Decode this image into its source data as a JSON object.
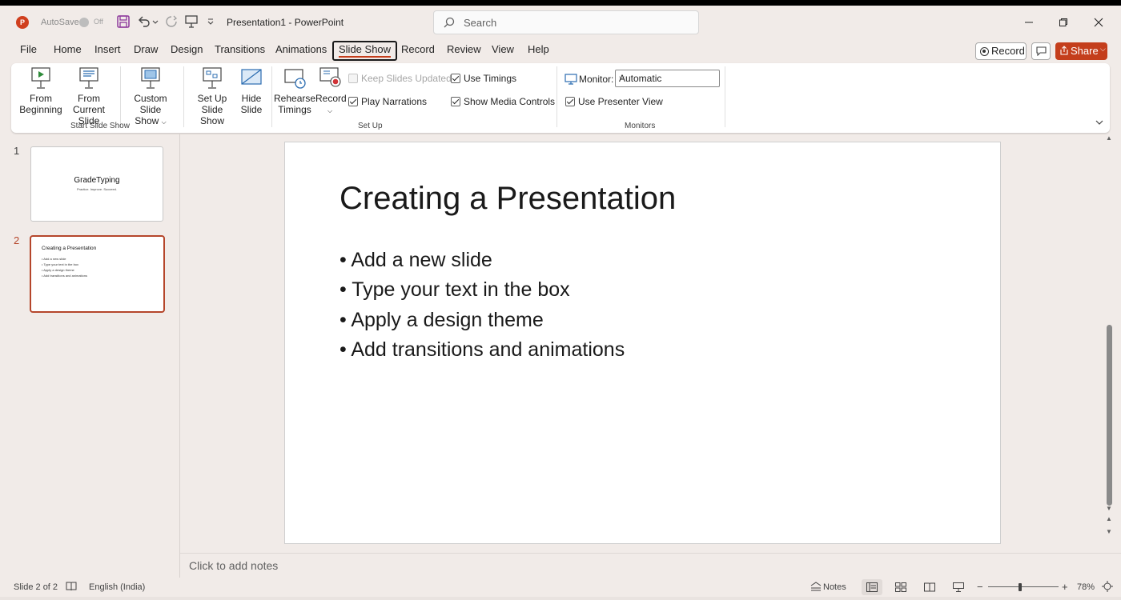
{
  "app": {
    "logo_letter": "P",
    "autosave_label": "AutoSave",
    "autosave_state": "Off",
    "document_title": "Presentation1  -  PowerPoint",
    "search_placeholder": "Search"
  },
  "menu": {
    "tabs": [
      "File",
      "Home",
      "Insert",
      "Draw",
      "Design",
      "Transitions",
      "Animations",
      "Slide Show",
      "Record",
      "Review",
      "View",
      "Help"
    ],
    "active_tab": "Slide Show",
    "record_button": "Record",
    "share_button": "Share"
  },
  "ribbon": {
    "start_group": {
      "label": "Start Slide Show",
      "from_beginning": [
        "From",
        "Beginning"
      ],
      "from_current": [
        "From",
        "Current Slide"
      ],
      "custom": [
        "Custom Slide",
        "Show"
      ]
    },
    "setup_group": {
      "label": "Set Up",
      "setup_show": [
        "Set Up",
        "Slide Show"
      ],
      "hide_slide": [
        "Hide",
        "Slide"
      ],
      "rehearse": [
        "Rehearse",
        "Timings"
      ],
      "record": "Record",
      "keep_updated": {
        "label": "Keep Slides Updated",
        "checked": false,
        "disabled": true
      },
      "play_narrations": {
        "label": "Play Narrations",
        "checked": true
      },
      "use_timings": {
        "label": "Use Timings",
        "checked": true
      },
      "show_media": {
        "label": "Show Media Controls",
        "checked": true
      }
    },
    "monitors_group": {
      "label": "Monitors",
      "monitor_label": "Monitor:",
      "monitor_value": "Automatic",
      "presenter_view": {
        "label": "Use Presenter View",
        "checked": true
      }
    }
  },
  "slides_panel": {
    "slides": [
      {
        "number": "1",
        "title": "GradeTyping",
        "subtitle": "Practice. Improve. Succeed."
      },
      {
        "number": "2",
        "title": "Creating a Presentation",
        "bullets": [
          "• Add a new slide",
          "• Type your text in the box",
          "• Apply a design theme",
          "• Add transitions and animations"
        ]
      }
    ]
  },
  "current_slide": {
    "title": "Creating a Presentation",
    "bullets": [
      "• Add a new slide",
      "• Type your text in the box",
      "• Apply a design theme",
      "• Add transitions and animations"
    ]
  },
  "notes_placeholder": "Click to add notes",
  "status": {
    "slide_counter": "Slide 2 of 2",
    "language": "English (India)",
    "notes_button": "Notes",
    "zoom_minus": "−",
    "zoom_plus": "+",
    "zoom_level": "78%",
    "zoom_fraction": 0.46
  },
  "colors": {
    "accent": "#c43e1c",
    "window_bg": "#f1ebe8"
  }
}
